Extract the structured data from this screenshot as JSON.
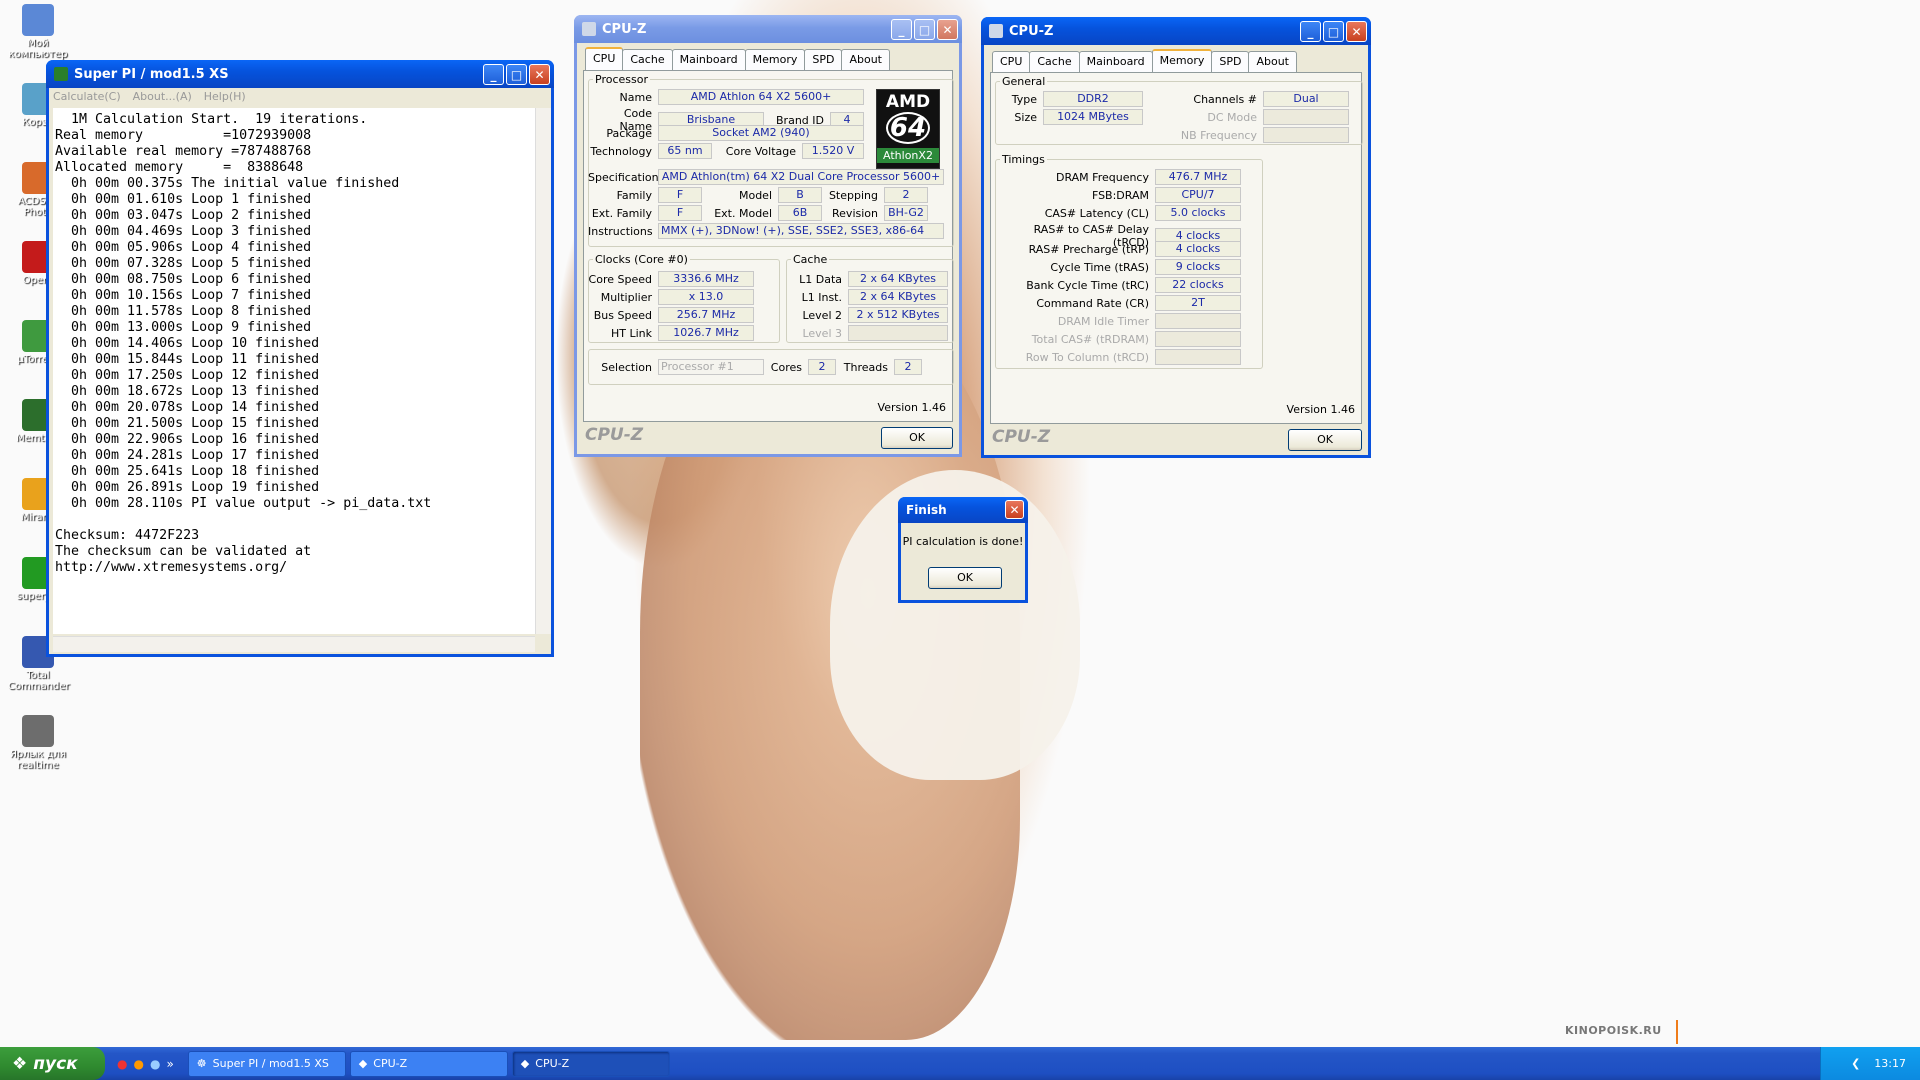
{
  "desktop": {
    "icons": [
      {
        "label": "Мой компьютер",
        "color": "#5b88d6"
      },
      {
        "label": "Корзи",
        "color": "#59a1c9"
      },
      {
        "label": "ACDSee Photo",
        "color": "#d86a2b"
      },
      {
        "label": "Opera",
        "color": "#c41b1b"
      },
      {
        "label": "µTorrent",
        "color": "#3f9a3f"
      },
      {
        "label": "Memtest",
        "color": "#2c6e2c"
      },
      {
        "label": "Mirand",
        "color": "#e9a21c"
      },
      {
        "label": "super_pi",
        "color": "#229a22"
      },
      {
        "label": "Total Commander",
        "color": "#3558b0"
      },
      {
        "label": "Ярлык для realtime",
        "color": "#6d6d6d"
      }
    ],
    "watermark": "KINOPOISK.RU"
  },
  "superpi": {
    "title": "Super PI / mod1.5 XS",
    "menu": [
      "Calculate(C)",
      "About...(A)",
      "Help(H)"
    ],
    "lines": [
      "  1M Calculation Start.  19 iterations.",
      "Real memory          =1072939008",
      "Available real memory =787488768",
      "Allocated memory     =  8388648",
      "  0h 00m 00.375s The initial value finished",
      "  0h 00m 01.610s Loop 1 finished",
      "  0h 00m 03.047s Loop 2 finished",
      "  0h 00m 04.469s Loop 3 finished",
      "  0h 00m 05.906s Loop 4 finished",
      "  0h 00m 07.328s Loop 5 finished",
      "  0h 00m 08.750s Loop 6 finished",
      "  0h 00m 10.156s Loop 7 finished",
      "  0h 00m 11.578s Loop 8 finished",
      "  0h 00m 13.000s Loop 9 finished",
      "  0h 00m 14.406s Loop 10 finished",
      "  0h 00m 15.844s Loop 11 finished",
      "  0h 00m 17.250s Loop 12 finished",
      "  0h 00m 18.672s Loop 13 finished",
      "  0h 00m 20.078s Loop 14 finished",
      "  0h 00m 21.500s Loop 15 finished",
      "  0h 00m 22.906s Loop 16 finished",
      "  0h 00m 24.281s Loop 17 finished",
      "  0h 00m 25.641s Loop 18 finished",
      "  0h 00m 26.891s Loop 19 finished",
      "  0h 00m 28.110s PI value output -> pi_data.txt",
      "",
      "Checksum: 4472F223",
      "The checksum can be validated at",
      "http://www.xtremesystems.org/"
    ]
  },
  "cpuz1": {
    "title": "CPU-Z",
    "tabs": [
      "CPU",
      "Cache",
      "Mainboard",
      "Memory",
      "SPD",
      "About"
    ],
    "processor_legend": "Processor",
    "name_label": "Name",
    "name": "AMD Athlon 64 X2 5600+",
    "codename_label": "Code Name",
    "codename": "Brisbane",
    "brandid_label": "Brand ID",
    "brandid": "4",
    "package_label": "Package",
    "package": "Socket AM2 (940)",
    "tech_label": "Technology",
    "tech": "65 nm",
    "voltage_label": "Core Voltage",
    "voltage": "1.520 V",
    "spec_label": "Specification",
    "spec": "AMD Athlon(tm) 64 X2 Dual Core Processor 5600+",
    "family_label": "Family",
    "family": "F",
    "model_label": "Model",
    "model": "B",
    "stepping_label": "Stepping",
    "stepping": "2",
    "extfamily_label": "Ext. Family",
    "extfamily": "F",
    "extmodel_label": "Ext. Model",
    "extmodel": "6B",
    "revision_label": "Revision",
    "revision": "BH-G2",
    "instr_label": "Instructions",
    "instr": "MMX (+), 3DNow! (+), SSE, SSE2, SSE3, x86-64",
    "logo_top": "AMD",
    "logo_mid": "64",
    "logo_bottom": "AthlonX2",
    "clocks_legend": "Clocks (Core #0)",
    "corespeed_label": "Core Speed",
    "corespeed": "3336.6 MHz",
    "mult_label": "Multiplier",
    "mult": "x 13.0",
    "bus_label": "Bus Speed",
    "bus": "256.7 MHz",
    "ht_label": "HT Link",
    "ht": "1026.7 MHz",
    "cache_legend": "Cache",
    "l1d_label": "L1 Data",
    "l1d": "2 x 64 KBytes",
    "l1i_label": "L1 Inst.",
    "l1i": "2 x 64 KBytes",
    "l2_label": "Level 2",
    "l2": "2 x 512 KBytes",
    "l3_label": "Level 3",
    "selection_label": "Selection",
    "selection": "Processor #1",
    "cores_label": "Cores",
    "cores": "2",
    "threads_label": "Threads",
    "threads": "2",
    "version": "Version 1.46",
    "brand": "CPU-Z",
    "ok": "OK"
  },
  "cpuz2": {
    "title": "CPU-Z",
    "tabs": [
      "CPU",
      "Cache",
      "Mainboard",
      "Memory",
      "SPD",
      "About"
    ],
    "general_legend": "General",
    "type_label": "Type",
    "type": "DDR2",
    "channels_label": "Channels #",
    "channels": "Dual",
    "size_label": "Size",
    "size": "1024 MBytes",
    "dcmode_label": "DC Mode",
    "nbfreq_label": "NB Frequency",
    "timings_legend": "Timings",
    "timings": [
      {
        "label": "DRAM Frequency",
        "value": "476.7 MHz"
      },
      {
        "label": "FSB:DRAM",
        "value": "CPU/7"
      },
      {
        "label": "CAS# Latency (CL)",
        "value": "5.0 clocks"
      },
      {
        "label": "RAS# to CAS# Delay (tRCD)",
        "value": "4 clocks"
      },
      {
        "label": "RAS# Precharge (tRP)",
        "value": "4 clocks"
      },
      {
        "label": "Cycle Time (tRAS)",
        "value": "9 clocks"
      },
      {
        "label": "Bank Cycle Time (tRC)",
        "value": "22 clocks"
      },
      {
        "label": "Command Rate (CR)",
        "value": "2T"
      }
    ],
    "timings_disabled": [
      "DRAM Idle Timer",
      "Total CAS# (tRDRAM)",
      "Row To Column (tRCD)"
    ],
    "version": "Version 1.46",
    "brand": "CPU-Z",
    "ok": "OK"
  },
  "finish": {
    "title": "Finish",
    "message": "PI calculation is done!",
    "ok": "OK"
  },
  "taskbar": {
    "start": "пуск",
    "tasks": [
      "Super PI / mod1.5 XS",
      "CPU-Z",
      "CPU-Z"
    ],
    "clock": "13:17"
  }
}
